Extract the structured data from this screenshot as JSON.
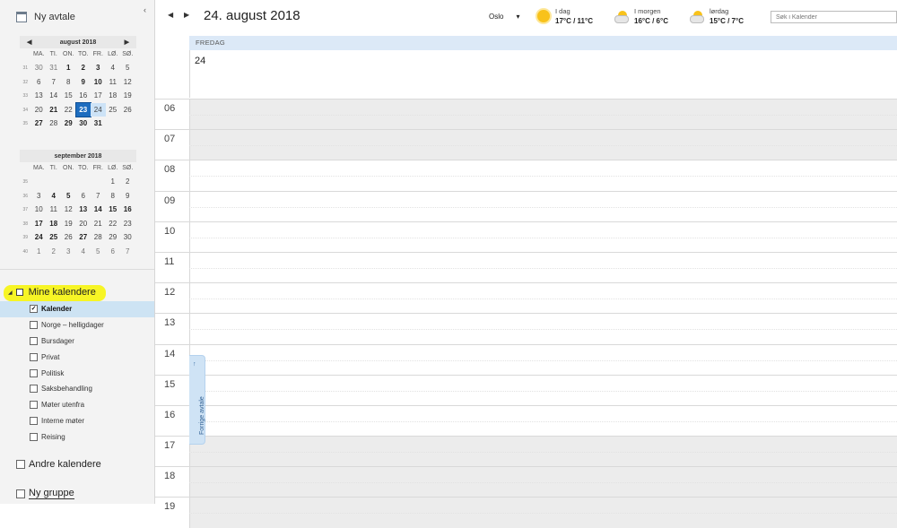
{
  "sidebar": {
    "new_appointment": "Ny avtale",
    "collapse_glyph": "‹",
    "months": [
      {
        "title": "august 2018",
        "weekdays": [
          "MA.",
          "TI.",
          "ON.",
          "TO.",
          "FR.",
          "LØ.",
          "SØ."
        ],
        "weeks": [
          {
            "wk": "31",
            "days": [
              "30",
              "31",
              "1",
              "2",
              "3",
              "4",
              "5"
            ]
          },
          {
            "wk": "32",
            "days": [
              "6",
              "7",
              "8",
              "9",
              "10",
              "11",
              "12"
            ]
          },
          {
            "wk": "33",
            "days": [
              "13",
              "14",
              "15",
              "16",
              "17",
              "18",
              "19"
            ]
          },
          {
            "wk": "34",
            "days": [
              "20",
              "21",
              "22",
              "23",
              "24",
              "25",
              "26"
            ]
          },
          {
            "wk": "35",
            "days": [
              "27",
              "28",
              "29",
              "30",
              "31",
              "",
              ""
            ]
          }
        ]
      },
      {
        "title": "september 2018",
        "weekdays": [
          "MA.",
          "TI.",
          "ON.",
          "TO.",
          "FR.",
          "LØ.",
          "SØ."
        ],
        "weeks": [
          {
            "wk": "35",
            "days": [
              "",
              "",
              "",
              "",
              "",
              "1",
              "2"
            ]
          },
          {
            "wk": "36",
            "days": [
              "3",
              "4",
              "5",
              "6",
              "7",
              "8",
              "9"
            ]
          },
          {
            "wk": "37",
            "days": [
              "10",
              "11",
              "12",
              "13",
              "14",
              "15",
              "16"
            ]
          },
          {
            "wk": "38",
            "days": [
              "17",
              "18",
              "19",
              "20",
              "21",
              "22",
              "23"
            ]
          },
          {
            "wk": "39",
            "days": [
              "24",
              "25",
              "26",
              "27",
              "28",
              "29",
              "30"
            ]
          },
          {
            "wk": "40",
            "days": [
              "1",
              "2",
              "3",
              "4",
              "5",
              "6",
              "7"
            ]
          }
        ]
      }
    ],
    "my_calendars": {
      "label": "Mine kalendere",
      "items": [
        {
          "label": "Kalender",
          "checked": true
        },
        {
          "label": "Norge – helligdager",
          "checked": false
        },
        {
          "label": "Bursdager",
          "checked": false
        },
        {
          "label": "Privat",
          "checked": false
        },
        {
          "label": "Politisk",
          "checked": false
        },
        {
          "label": "Saksbehandling",
          "checked": false
        },
        {
          "label": "Møter utenfra",
          "checked": false
        },
        {
          "label": "Interne møter",
          "checked": false
        },
        {
          "label": "Reising",
          "checked": false
        }
      ]
    },
    "other_calendars": "Andre kalendere",
    "new_group": "Ny gruppe"
  },
  "topbar": {
    "date_title": "24. august 2018",
    "city": "Oslo",
    "weather": [
      {
        "label": "I dag",
        "temp": "17°C / 11°C",
        "icon": "sun-icon"
      },
      {
        "label": "I morgen",
        "temp": "16°C / 6°C",
        "icon": "partly-cloudy-icon"
      },
      {
        "label": "lørdag",
        "temp": "15°C / 7°C",
        "icon": "partly-cloudy-icon"
      }
    ],
    "search_placeholder": "Søk i Kalender"
  },
  "dayview": {
    "weekday": "FREDAG",
    "day_number": "24",
    "hours": [
      "06",
      "07",
      "08",
      "09",
      "10",
      "11",
      "12",
      "13",
      "14",
      "15",
      "16",
      "17",
      "18",
      "19"
    ],
    "previous_appointment": "Forrige avtale"
  },
  "colors": {
    "today_highlight": "#1e6dbf",
    "selected_day": "#cde3f7",
    "marker_highlight": "#f7f400",
    "day_header": "#dce9f7"
  }
}
